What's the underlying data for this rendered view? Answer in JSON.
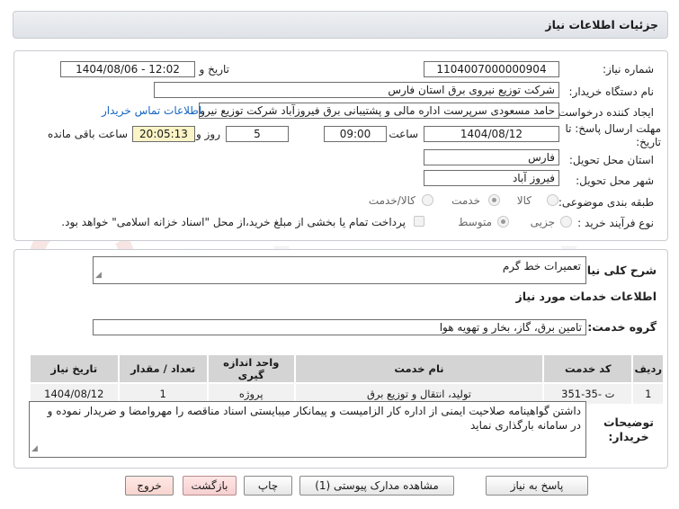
{
  "window": {
    "title": "جزئیات اطلاعات نیاز"
  },
  "watermark": {
    "text": "AriaTender.net"
  },
  "form": {
    "need_number_label": "شماره نیاز:",
    "need_number": "1104007000000904",
    "announce_label": "تاریخ و ساعت اعلان عمومی:",
    "announce_value": "1404/08/06 - 12:02",
    "buyer_org_label": "نام دستگاه خریدار:",
    "buyer_org": "شرکت توزیع نیروی برق استان فارس",
    "creator_label": "ایجاد کننده درخواست:",
    "creator": "حامد مسعودی سرپرست اداره مالی و پشتیبانی برق فیروزآباد شرکت توزیع نیروی",
    "contact_link": "اطلاعات تماس خریدار",
    "deadline_label": "مهلت ارسال پاسخ: تا تاریخ:",
    "deadline_date": "1404/08/12",
    "time_label": "ساعت",
    "deadline_time": "09:00",
    "days": "5",
    "days_label": "روز و",
    "remaining_time": "20:05:13",
    "remaining_label": "ساعت باقی مانده",
    "province_label": "استان محل تحویل:",
    "province": "فارس",
    "city_label": "شهر محل تحویل:",
    "city": "فیروز آباد",
    "category_label": "طبقه بندی موضوعی:",
    "category_options": [
      "کالا",
      "خدمت",
      "کالا/خدمت"
    ],
    "category_selected": "خدمت",
    "process_label": "نوع فرآیند خرید :",
    "process_options": [
      "جزیی",
      "متوسط"
    ],
    "process_selected": "متوسط",
    "payment_note": "پرداخت تمام یا بخشی از مبلغ خرید،از محل \"اسناد خزانه اسلامی\" خواهد بود."
  },
  "general": {
    "desc_label": "شرح کلی نیاز:",
    "desc_value": "تعمیرات خط گرم",
    "services_title": "اطلاعات خدمات مورد نیاز",
    "group_label": "گروه خدمت:",
    "group_value": "تامین برق، گاز، بخار و تهویه هوا"
  },
  "table": {
    "headers": [
      "ردیف",
      "کد خدمت",
      "نام خدمت",
      "واحد اندازه گیری",
      "تعداد / مقدار",
      "تاریخ نیاز"
    ],
    "rows": [
      [
        "1",
        "ت -35-351",
        "تولید، انتقال و توزیع برق",
        "پروژه",
        "1",
        "1404/08/12"
      ]
    ]
  },
  "buyer_notes": {
    "label": "توضیحات خریدار:",
    "text": "داشتن گواهینامه صلاحیت ایمنی از اداره کار الزامیست و پیمانکار میبایستی اسناد مناقصه را مهروامضا و ضریدار نموده و در سامانه بارگذاری نماید"
  },
  "buttons": {
    "reply": "پاسخ به نیاز",
    "attachments": "مشاهده مدارک پیوستی (1)",
    "print": "چاپ",
    "back": "بازگشت",
    "exit": "خروج"
  },
  "colors": {
    "link": "#1565c0",
    "highlight": "#fbf4c6",
    "header_bg": "#d4d4d4"
  }
}
